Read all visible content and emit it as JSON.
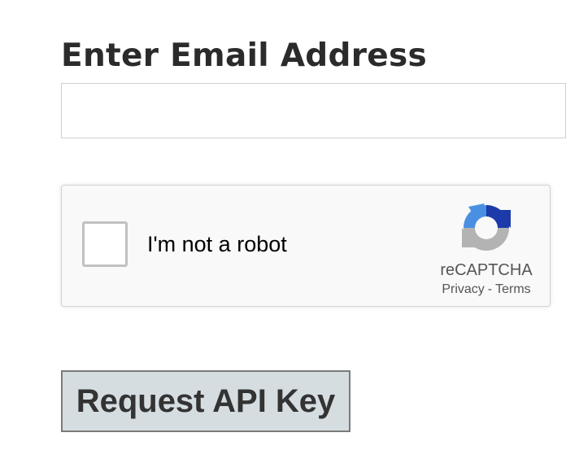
{
  "form": {
    "email_label": "Enter Email Address",
    "email_value": "",
    "email_placeholder": "",
    "submit_label": "Request API Key"
  },
  "recaptcha": {
    "checkbox_label": "I'm not a robot",
    "brand": "reCAPTCHA",
    "privacy_link": "Privacy",
    "separator": "-",
    "terms_link": "Terms",
    "logo_icon": "recaptcha-logo-icon",
    "colors": {
      "logo_dark_blue": "#1c3aa9",
      "logo_light_blue": "#4a90e2",
      "logo_gray": "#b3b3b3"
    }
  }
}
